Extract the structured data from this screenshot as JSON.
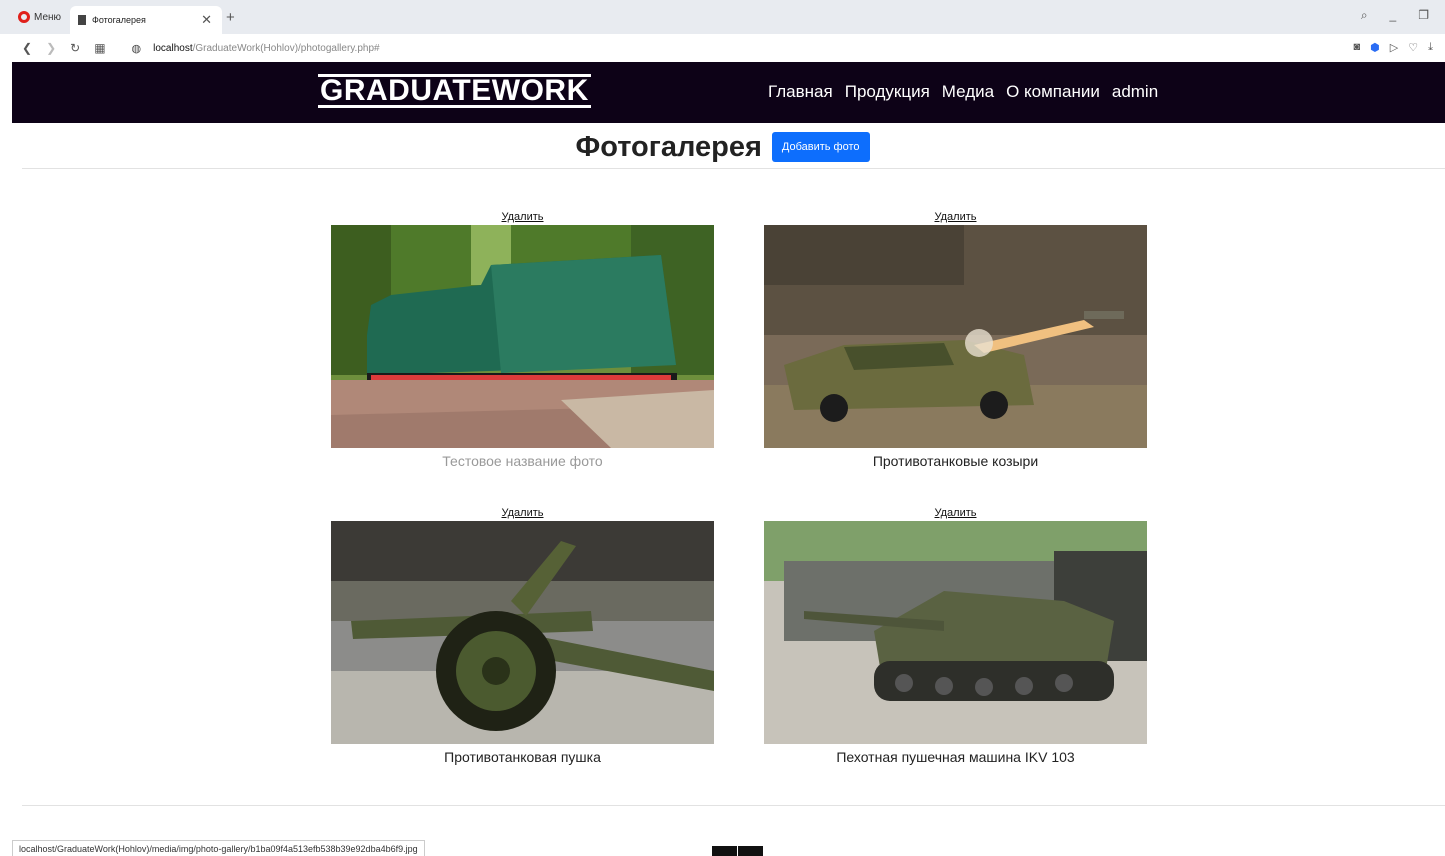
{
  "browser": {
    "menu_label": "Меню",
    "tab_title": "Фотогалерея",
    "url_host": "localhost",
    "url_path": "/GraduateWork(Hohlov)/photogallery.php#",
    "status_url": "localhost/GraduateWork(Hohlov)/media/img/photo-gallery/b1ba09f4a513efb538b39e92dba4b6f9.jpg"
  },
  "site": {
    "logo": "GRADUATEWORK",
    "nav": [
      "Главная",
      "Продукция",
      "Медиа",
      "О компании",
      "admin"
    ]
  },
  "page": {
    "title": "Фотогалерея",
    "add_button": "Добавить фото"
  },
  "gallery": [
    {
      "delete_label": "Удалить",
      "caption": "Тестовое название фото",
      "muted": true,
      "image": "armored-train-photo"
    },
    {
      "delete_label": "Удалить",
      "caption": "Противотанковые козыри",
      "muted": false,
      "image": "missile-vehicle-photo"
    },
    {
      "delete_label": "Удалить",
      "caption": "Противотанковая пушка",
      "muted": false,
      "image": "anti-tank-gun-photo"
    },
    {
      "delete_label": "Удалить",
      "caption": "Пехотная пушечная машина IKV 103",
      "muted": false,
      "image": "ikv103-photo"
    }
  ]
}
